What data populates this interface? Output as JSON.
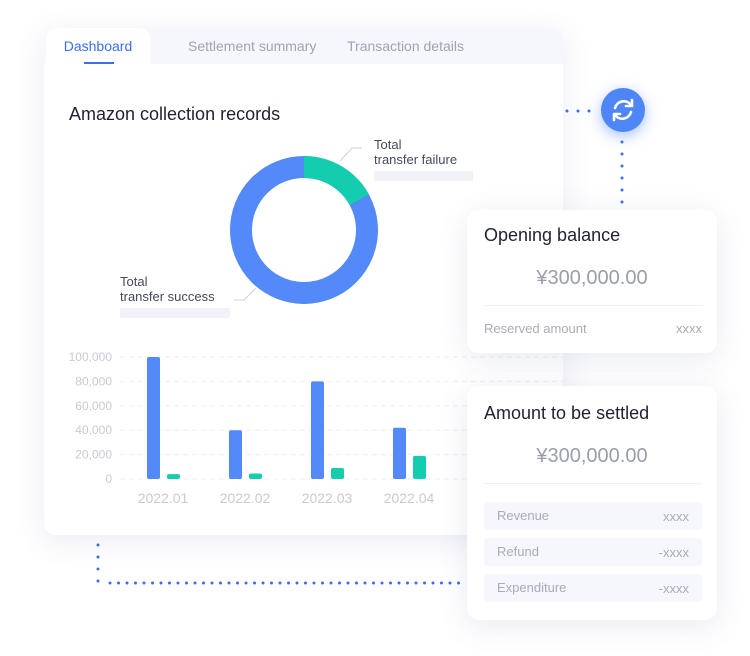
{
  "tabs": [
    {
      "label": "Dashboard",
      "active": true
    },
    {
      "label": "Settlement summary"
    },
    {
      "label": "Transaction details"
    }
  ],
  "main": {
    "title": "Amazon collection records",
    "donut": {
      "failure_label": "Total\ntransfer failure",
      "success_label": "Total\ntransfer success",
      "failure_share": 0.17,
      "colors": {
        "success": "#5389f8",
        "failure": "#14cdae"
      }
    }
  },
  "chart_data": {
    "type": "bar",
    "categories": [
      "2022.01",
      "2022.02",
      "2022.03",
      "2022.04"
    ],
    "series": [
      {
        "values": [
          100000,
          40000,
          80000,
          42000
        ],
        "color": "#5389f8"
      },
      {
        "values": [
          4000,
          4500,
          9000,
          19000
        ],
        "color": "#14cdae"
      }
    ],
    "ylim": [
      0,
      100000
    ],
    "yticks": [
      "0",
      "20,000",
      "40,000",
      "60,000",
      "80,000",
      "100,000"
    ],
    "grid": true
  },
  "opening": {
    "title": "Opening balance",
    "amount": "¥300,000.00",
    "reserved_label": "Reserved amount",
    "reserved_value": "xxxx"
  },
  "settle": {
    "title": "Amount to be settled",
    "amount": "¥300,000.00",
    "rows": [
      {
        "label": "Revenue",
        "value": "xxxx"
      },
      {
        "label": "Refund",
        "value": "-xxxx"
      },
      {
        "label": "Expenditure",
        "value": "-xxxx"
      }
    ]
  },
  "icons": {
    "refresh": "refresh-icon"
  }
}
